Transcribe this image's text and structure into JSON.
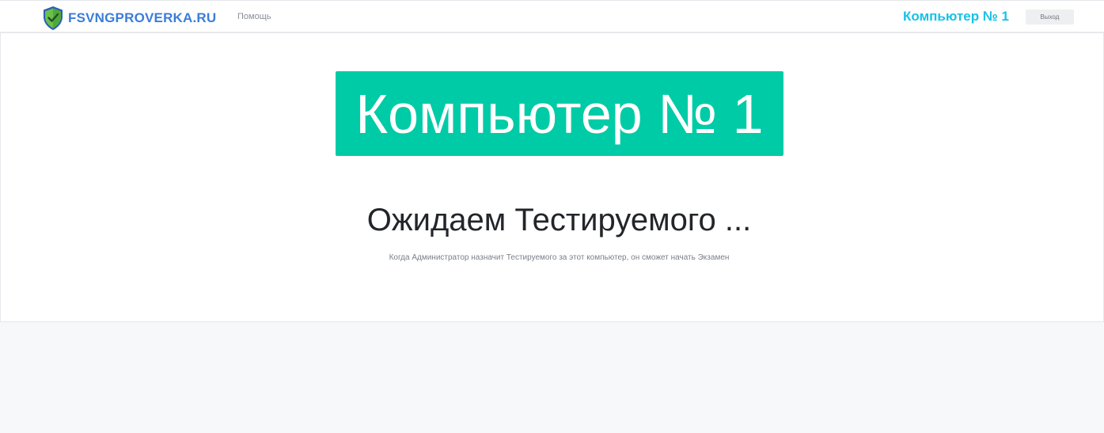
{
  "navbar": {
    "brand_name": "FSVNGPROVERKA.RU",
    "help_link": "Помощь",
    "computer_label": "Компьютер № 1",
    "logout_button": "Выход",
    "icon": "shield-check-icon"
  },
  "main": {
    "computer_banner": "Компьютер № 1",
    "waiting_title": "Ожидаем Тестируемого ...",
    "waiting_subtitle": "Когда Администратор назначит Тестируемого за этот компьютер, он сможет начать Экзамен"
  },
  "colors": {
    "brand": "#3b7dd8",
    "computer_label": "#18c2e6",
    "banner_bg": "#00cba7",
    "page_bg": "#f7f8fa"
  }
}
